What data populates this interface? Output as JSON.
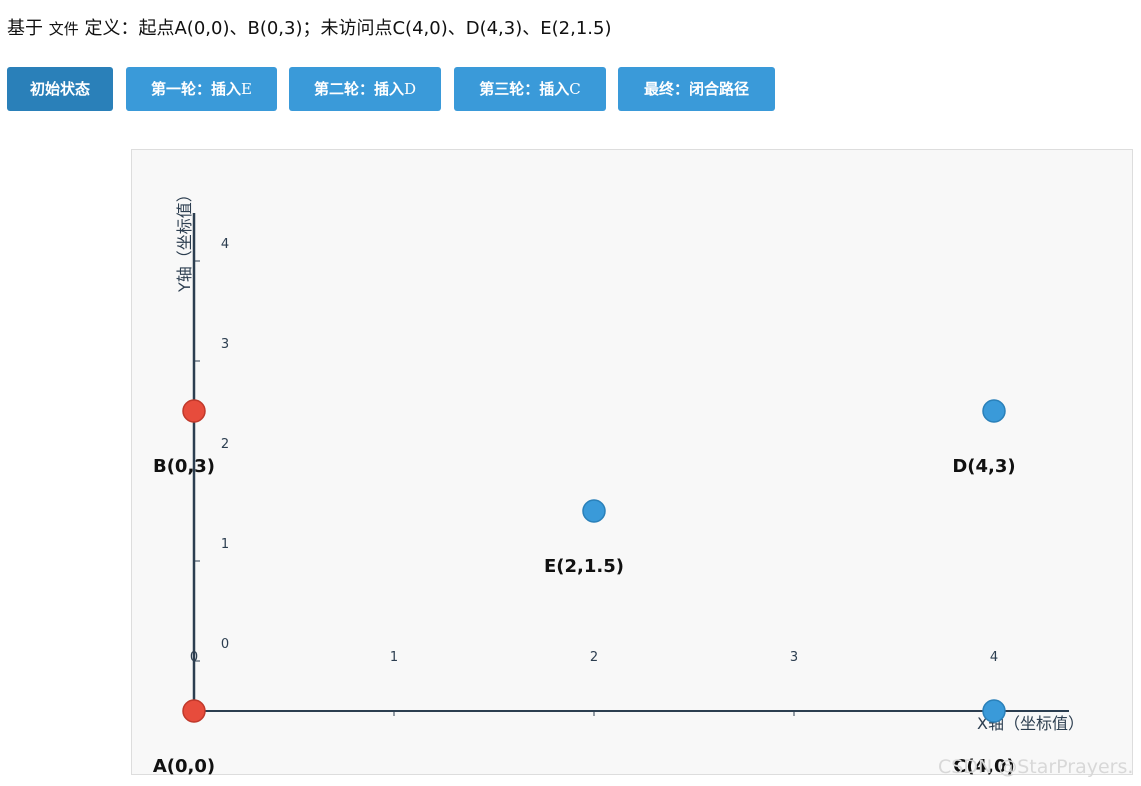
{
  "header": {
    "prefix": "基于",
    "doc_word": "文件",
    "suffix": "定义：起点A(0,0)、B(0,3)；未访问点C(4,0)、D(4,3)、E(2,1.5)"
  },
  "buttons": [
    {
      "main": "第一轮：插入",
      "sfx": "E"
    },
    {
      "main": "第二轮：插入",
      "sfx": "D"
    },
    {
      "main": "第三轮：插入",
      "sfx": "C"
    }
  ],
  "button_initial": "初始状态",
  "button_final": "最终：闭合路径",
  "active_button": "初始状态",
  "colors": {
    "visited": "#e74c3c",
    "unvisited": "#3a9ad9",
    "axis": "#2c3e50",
    "button": "#3a9ad9",
    "button_active": "#2a80b9"
  },
  "chart_data": {
    "type": "scatter",
    "xlabel": "X轴（坐标值）",
    "ylabel": "Y轴（坐标值）",
    "x_ticks": [
      "0",
      "1",
      "2",
      "3",
      "4"
    ],
    "y_ticks": [
      "0",
      "1",
      "2",
      "3",
      "4"
    ],
    "xlim": [
      0,
      4
    ],
    "ylim": [
      0,
      4
    ],
    "points": [
      {
        "label": "A(0,0)",
        "x": 0,
        "y": 0,
        "state": "visited"
      },
      {
        "label": "B(0,3)",
        "x": 0,
        "y": 3,
        "state": "visited"
      },
      {
        "label": "C(4,0)",
        "x": 4,
        "y": 0,
        "state": "unvisited"
      },
      {
        "label": "D(4,3)",
        "x": 4,
        "y": 3,
        "state": "unvisited"
      },
      {
        "label": "E(2,1.5)",
        "x": 2,
        "y": 1.5,
        "state": "unvisited"
      }
    ]
  },
  "watermark": "CSDN @StarPrayers."
}
